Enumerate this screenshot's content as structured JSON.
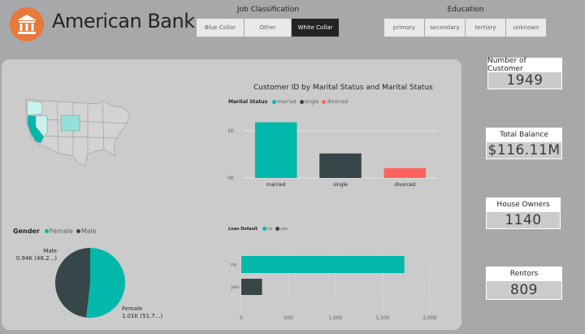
{
  "header": {
    "title": "American Bank",
    "logo_icon": "bank-icon",
    "logo_color": "#e8793a"
  },
  "job_slicer": {
    "title": "Job Classification",
    "options": [
      "Blue Collar",
      "Other",
      "White Collar"
    ],
    "selected": "White Collar"
  },
  "education_slicer": {
    "title": "Education",
    "options": [
      "primary",
      "secondary",
      "tertiary",
      "unknown"
    ]
  },
  "cards": [
    {
      "label": "Number of Customer",
      "value": "1949"
    },
    {
      "label": "Total Balance",
      "value": "$116.11M"
    },
    {
      "label": "House Owners",
      "value": "1140"
    },
    {
      "label": "Rentors",
      "value": "809"
    }
  ],
  "colors": {
    "teal": "#01b8aa",
    "dark": "#374649",
    "red": "#fd625e",
    "map_light": "#c9f1ee",
    "map_mid": "#96dfd8"
  },
  "chart_data": [
    {
      "type": "map",
      "highlighted_states": [
        "California",
        "Oregon",
        "Nevada",
        "Idaho"
      ],
      "intensity": {
        "California": "high",
        "Oregon": "low",
        "Nevada": "medium",
        "Idaho": "medium"
      }
    },
    {
      "type": "bar",
      "title": "Customer ID by Marital Status and Marital Status",
      "legend_title": "Marital Status",
      "categories": [
        "married",
        "single",
        "divorced"
      ],
      "values": [
        1180,
        520,
        210
      ],
      "colors": [
        "#01b8aa",
        "#374649",
        "#fd625e"
      ],
      "yticks": [
        "0K",
        "1K"
      ],
      "ylim": [
        0,
        1500
      ]
    },
    {
      "type": "pie",
      "legend_title": "Gender",
      "slices": [
        {
          "name": "Female",
          "value": 1010,
          "label": "Female",
          "sublabel": "1.01K (51.7...)",
          "color": "#01b8aa"
        },
        {
          "name": "Male",
          "value": 940,
          "label": "Male",
          "sublabel": "0.94K (48.2...)",
          "color": "#374649"
        }
      ]
    },
    {
      "type": "bar",
      "orientation": "horizontal",
      "legend_title": "Loan Default",
      "categories": [
        "no",
        "yes"
      ],
      "values": [
        1730,
        220
      ],
      "colors": [
        "#01b8aa",
        "#374649"
      ],
      "xticks": [
        "0",
        "500",
        "1,000",
        "1,500",
        "2,000"
      ],
      "xlim": [
        0,
        2000
      ]
    }
  ]
}
